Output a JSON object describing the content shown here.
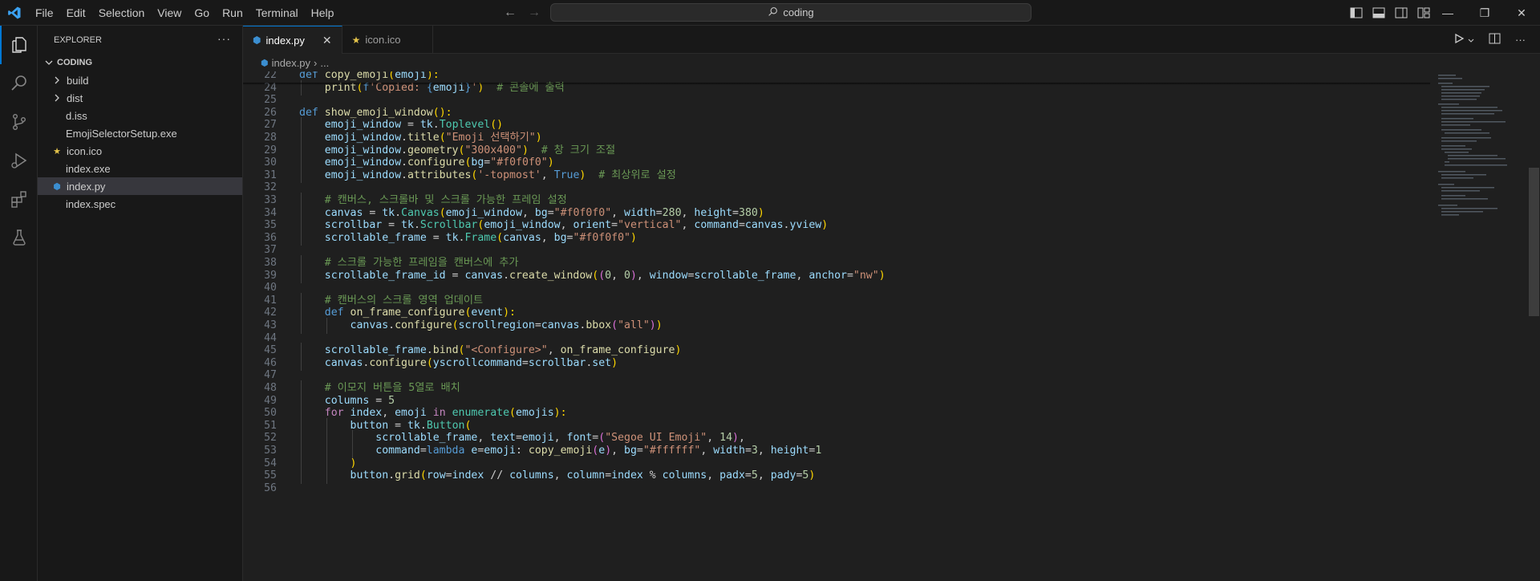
{
  "menu": [
    "File",
    "Edit",
    "Selection",
    "View",
    "Go",
    "Run",
    "Terminal",
    "Help"
  ],
  "search": {
    "text": "coding"
  },
  "explorer": {
    "title": "EXPLORER",
    "more": "···",
    "folder": "CODING",
    "items": [
      {
        "label": "build",
        "kind": "folder"
      },
      {
        "label": "dist",
        "kind": "folder"
      },
      {
        "label": "d.iss",
        "kind": "file"
      },
      {
        "label": "EmojiSelectorSetup.exe",
        "kind": "file"
      },
      {
        "label": "icon.ico",
        "kind": "icon"
      },
      {
        "label": "index.exe",
        "kind": "file"
      },
      {
        "label": "index.py",
        "kind": "python",
        "selected": true
      },
      {
        "label": "index.spec",
        "kind": "file"
      }
    ]
  },
  "tabs": [
    {
      "label": "index.py",
      "icon": "python-icon",
      "active": true,
      "close": "✕"
    },
    {
      "label": "icon.ico",
      "icon": "star-icon",
      "active": false
    }
  ],
  "breadcrumb": {
    "file": "index.py",
    "sep": "›",
    "more": "..."
  },
  "colors": {
    "accent": "#0078d4",
    "keyword": "#c586c0",
    "def": "#569cd6",
    "func": "#dcdcaa",
    "var": "#9cdcfe",
    "class": "#4ec9b0",
    "string": "#ce9178",
    "number": "#b5cea8",
    "comment": "#6a9955",
    "bracket1": "#ffd700",
    "bracket2": "#da70d6",
    "bracket3": "#179fff"
  },
  "code_lines": [
    {
      "n": "22",
      "indent": 0,
      "tokens": [
        [
          "def ",
          "d"
        ],
        [
          "copy_emoji",
          "f"
        ],
        [
          "(",
          "b1"
        ],
        [
          "emoji",
          "v"
        ],
        [
          "):",
          "b1"
        ]
      ]
    },
    {
      "n": "24",
      "indent": 1,
      "tokens": [
        [
          "print",
          "f"
        ],
        [
          "(",
          "b1"
        ],
        [
          "f",
          "d"
        ],
        [
          "'Copied: ",
          "s"
        ],
        [
          "{",
          "d"
        ],
        [
          "emoji",
          "v"
        ],
        [
          "}",
          "d"
        ],
        [
          "'",
          "s"
        ],
        [
          ")",
          "b1"
        ],
        [
          "  # 콘솔에 출력",
          "c"
        ]
      ]
    },
    {
      "n": "25",
      "indent": 0,
      "tokens": []
    },
    {
      "n": "26",
      "indent": 0,
      "tokens": [
        [
          "def ",
          "d"
        ],
        [
          "show_emoji_window",
          "f"
        ],
        [
          "():",
          "b1"
        ]
      ]
    },
    {
      "n": "27",
      "indent": 1,
      "tokens": [
        [
          "emoji_window",
          "v"
        ],
        [
          " = ",
          "p"
        ],
        [
          "tk",
          "v"
        ],
        [
          ".",
          "p"
        ],
        [
          "Toplevel",
          "k"
        ],
        [
          "()",
          "b1"
        ]
      ]
    },
    {
      "n": "28",
      "indent": 1,
      "tokens": [
        [
          "emoji_window",
          "v"
        ],
        [
          ".",
          "p"
        ],
        [
          "title",
          "f"
        ],
        [
          "(",
          "b1"
        ],
        [
          "\"Emoji 선택하기\"",
          "s"
        ],
        [
          ")",
          "b1"
        ]
      ]
    },
    {
      "n": "29",
      "indent": 1,
      "tokens": [
        [
          "emoji_window",
          "v"
        ],
        [
          ".",
          "p"
        ],
        [
          "geometry",
          "f"
        ],
        [
          "(",
          "b1"
        ],
        [
          "\"300x400\"",
          "s"
        ],
        [
          ")",
          "b1"
        ],
        [
          "  # 창 크기 조절",
          "c"
        ]
      ]
    },
    {
      "n": "30",
      "indent": 1,
      "tokens": [
        [
          "emoji_window",
          "v"
        ],
        [
          ".",
          "p"
        ],
        [
          "configure",
          "f"
        ],
        [
          "(",
          "b1"
        ],
        [
          "bg",
          "v"
        ],
        [
          "=",
          "p"
        ],
        [
          "\"#f0f0f0\"",
          "s"
        ],
        [
          ")",
          "b1"
        ]
      ]
    },
    {
      "n": "31",
      "indent": 1,
      "tokens": [
        [
          "emoji_window",
          "v"
        ],
        [
          ".",
          "p"
        ],
        [
          "attributes",
          "f"
        ],
        [
          "(",
          "b1"
        ],
        [
          "'-topmost'",
          "s"
        ],
        [
          ", ",
          "p"
        ],
        [
          "True",
          "d"
        ],
        [
          ")",
          "b1"
        ],
        [
          "  # 최상위로 설정",
          "c"
        ]
      ]
    },
    {
      "n": "32",
      "indent": 0,
      "tokens": []
    },
    {
      "n": "33",
      "indent": 1,
      "tokens": [
        [
          "# 캔버스, 스크롤바 및 스크롤 가능한 프레임 설정",
          "c"
        ]
      ]
    },
    {
      "n": "34",
      "indent": 1,
      "tokens": [
        [
          "canvas",
          "v"
        ],
        [
          " = ",
          "p"
        ],
        [
          "tk",
          "v"
        ],
        [
          ".",
          "p"
        ],
        [
          "Canvas",
          "k"
        ],
        [
          "(",
          "b1"
        ],
        [
          "emoji_window",
          "v"
        ],
        [
          ", ",
          "p"
        ],
        [
          "bg",
          "v"
        ],
        [
          "=",
          "p"
        ],
        [
          "\"#f0f0f0\"",
          "s"
        ],
        [
          ", ",
          "p"
        ],
        [
          "width",
          "v"
        ],
        [
          "=",
          "p"
        ],
        [
          "280",
          "n"
        ],
        [
          ", ",
          "p"
        ],
        [
          "height",
          "v"
        ],
        [
          "=",
          "p"
        ],
        [
          "380",
          "n"
        ],
        [
          ")",
          "b1"
        ]
      ]
    },
    {
      "n": "35",
      "indent": 1,
      "tokens": [
        [
          "scrollbar",
          "v"
        ],
        [
          " = ",
          "p"
        ],
        [
          "tk",
          "v"
        ],
        [
          ".",
          "p"
        ],
        [
          "Scrollbar",
          "k"
        ],
        [
          "(",
          "b1"
        ],
        [
          "emoji_window",
          "v"
        ],
        [
          ", ",
          "p"
        ],
        [
          "orient",
          "v"
        ],
        [
          "=",
          "p"
        ],
        [
          "\"vertical\"",
          "s"
        ],
        [
          ", ",
          "p"
        ],
        [
          "command",
          "v"
        ],
        [
          "=",
          "p"
        ],
        [
          "canvas",
          "v"
        ],
        [
          ".",
          "p"
        ],
        [
          "yview",
          "v"
        ],
        [
          ")",
          "b1"
        ]
      ]
    },
    {
      "n": "36",
      "indent": 1,
      "tokens": [
        [
          "scrollable_frame",
          "v"
        ],
        [
          " = ",
          "p"
        ],
        [
          "tk",
          "v"
        ],
        [
          ".",
          "p"
        ],
        [
          "Frame",
          "k"
        ],
        [
          "(",
          "b1"
        ],
        [
          "canvas",
          "v"
        ],
        [
          ", ",
          "p"
        ],
        [
          "bg",
          "v"
        ],
        [
          "=",
          "p"
        ],
        [
          "\"#f0f0f0\"",
          "s"
        ],
        [
          ")",
          "b1"
        ]
      ]
    },
    {
      "n": "37",
      "indent": 0,
      "tokens": []
    },
    {
      "n": "38",
      "indent": 1,
      "tokens": [
        [
          "# 스크롤 가능한 프레임을 캔버스에 추가",
          "c"
        ]
      ]
    },
    {
      "n": "39",
      "indent": 1,
      "tokens": [
        [
          "scrollable_frame_id",
          "v"
        ],
        [
          " = ",
          "p"
        ],
        [
          "canvas",
          "v"
        ],
        [
          ".",
          "p"
        ],
        [
          "create_window",
          "f"
        ],
        [
          "(",
          "b1"
        ],
        [
          "(",
          "b2"
        ],
        [
          "0",
          "n"
        ],
        [
          ", ",
          "p"
        ],
        [
          "0",
          "n"
        ],
        [
          ")",
          "b2"
        ],
        [
          ", ",
          "p"
        ],
        [
          "window",
          "v"
        ],
        [
          "=",
          "p"
        ],
        [
          "scrollable_frame",
          "v"
        ],
        [
          ", ",
          "p"
        ],
        [
          "anchor",
          "v"
        ],
        [
          "=",
          "p"
        ],
        [
          "\"nw\"",
          "s"
        ],
        [
          ")",
          "b1"
        ]
      ]
    },
    {
      "n": "40",
      "indent": 0,
      "tokens": []
    },
    {
      "n": "41",
      "indent": 1,
      "tokens": [
        [
          "# 캔버스의 스크롤 영역 업데이트",
          "c"
        ]
      ]
    },
    {
      "n": "42",
      "indent": 1,
      "tokens": [
        [
          "def ",
          "d"
        ],
        [
          "on_frame_configure",
          "f"
        ],
        [
          "(",
          "b1"
        ],
        [
          "event",
          "v"
        ],
        [
          "):",
          "b1"
        ]
      ]
    },
    {
      "n": "43",
      "indent": 2,
      "tokens": [
        [
          "canvas",
          "v"
        ],
        [
          ".",
          "p"
        ],
        [
          "configure",
          "f"
        ],
        [
          "(",
          "b1"
        ],
        [
          "scrollregion",
          "v"
        ],
        [
          "=",
          "p"
        ],
        [
          "canvas",
          "v"
        ],
        [
          ".",
          "p"
        ],
        [
          "bbox",
          "f"
        ],
        [
          "(",
          "b2"
        ],
        [
          "\"all\"",
          "s"
        ],
        [
          ")",
          "b2"
        ],
        [
          ")",
          "b1"
        ]
      ]
    },
    {
      "n": "44",
      "indent": 0,
      "tokens": []
    },
    {
      "n": "45",
      "indent": 1,
      "tokens": [
        [
          "scrollable_frame",
          "v"
        ],
        [
          ".",
          "p"
        ],
        [
          "bind",
          "f"
        ],
        [
          "(",
          "b1"
        ],
        [
          "\"<Configure>\"",
          "s"
        ],
        [
          ", ",
          "p"
        ],
        [
          "on_frame_configure",
          "f"
        ],
        [
          ")",
          "b1"
        ]
      ]
    },
    {
      "n": "46",
      "indent": 1,
      "tokens": [
        [
          "canvas",
          "v"
        ],
        [
          ".",
          "p"
        ],
        [
          "configure",
          "f"
        ],
        [
          "(",
          "b1"
        ],
        [
          "yscrollcommand",
          "v"
        ],
        [
          "=",
          "p"
        ],
        [
          "scrollbar",
          "v"
        ],
        [
          ".",
          "p"
        ],
        [
          "set",
          "v"
        ],
        [
          ")",
          "b1"
        ]
      ]
    },
    {
      "n": "47",
      "indent": 0,
      "tokens": []
    },
    {
      "n": "48",
      "indent": 1,
      "tokens": [
        [
          "# 이모지 버튼을 5열로 배치",
          "c"
        ]
      ]
    },
    {
      "n": "49",
      "indent": 1,
      "tokens": [
        [
          "columns",
          "v"
        ],
        [
          " = ",
          "p"
        ],
        [
          "5",
          "n"
        ]
      ]
    },
    {
      "n": "50",
      "indent": 1,
      "tokens": [
        [
          "for ",
          "kw"
        ],
        [
          "index",
          "v"
        ],
        [
          ", ",
          "p"
        ],
        [
          "emoji",
          "v"
        ],
        [
          " in ",
          "kw"
        ],
        [
          "enumerate",
          "k"
        ],
        [
          "(",
          "b1"
        ],
        [
          "emojis",
          "v"
        ],
        [
          "):",
          "b1"
        ]
      ]
    },
    {
      "n": "51",
      "indent": 2,
      "tokens": [
        [
          "button",
          "v"
        ],
        [
          " = ",
          "p"
        ],
        [
          "tk",
          "v"
        ],
        [
          ".",
          "p"
        ],
        [
          "Button",
          "k"
        ],
        [
          "(",
          "b1"
        ]
      ]
    },
    {
      "n": "52",
      "indent": 3,
      "tokens": [
        [
          "scrollable_frame",
          "v"
        ],
        [
          ", ",
          "p"
        ],
        [
          "text",
          "v"
        ],
        [
          "=",
          "p"
        ],
        [
          "emoji",
          "v"
        ],
        [
          ", ",
          "p"
        ],
        [
          "font",
          "v"
        ],
        [
          "=",
          "p"
        ],
        [
          "(",
          "b2"
        ],
        [
          "\"Segoe UI Emoji\"",
          "s"
        ],
        [
          ", ",
          "p"
        ],
        [
          "14",
          "n"
        ],
        [
          ")",
          "b2"
        ],
        [
          ",",
          "p"
        ]
      ]
    },
    {
      "n": "53",
      "indent": 3,
      "tokens": [
        [
          "command",
          "v"
        ],
        [
          "=",
          "p"
        ],
        [
          "lambda ",
          "d"
        ],
        [
          "e",
          "v"
        ],
        [
          "=",
          "p"
        ],
        [
          "emoji",
          "v"
        ],
        [
          ": ",
          "p"
        ],
        [
          "copy_emoji",
          "f"
        ],
        [
          "(",
          "b2"
        ],
        [
          "e",
          "v"
        ],
        [
          ")",
          "b2"
        ],
        [
          ", ",
          "p"
        ],
        [
          "bg",
          "v"
        ],
        [
          "=",
          "p"
        ],
        [
          "\"#ffffff\"",
          "s"
        ],
        [
          ", ",
          "p"
        ],
        [
          "width",
          "v"
        ],
        [
          "=",
          "p"
        ],
        [
          "3",
          "n"
        ],
        [
          ", ",
          "p"
        ],
        [
          "height",
          "v"
        ],
        [
          "=",
          "p"
        ],
        [
          "1",
          "n"
        ]
      ]
    },
    {
      "n": "54",
      "indent": 2,
      "tokens": [
        [
          ")",
          "b1"
        ]
      ]
    },
    {
      "n": "55",
      "indent": 2,
      "tokens": [
        [
          "button",
          "v"
        ],
        [
          ".",
          "p"
        ],
        [
          "grid",
          "f"
        ],
        [
          "(",
          "b1"
        ],
        [
          "row",
          "v"
        ],
        [
          "=",
          "p"
        ],
        [
          "index",
          "v"
        ],
        [
          " // ",
          "p"
        ],
        [
          "columns",
          "v"
        ],
        [
          ", ",
          "p"
        ],
        [
          "column",
          "v"
        ],
        [
          "=",
          "p"
        ],
        [
          "index",
          "v"
        ],
        [
          " % ",
          "p"
        ],
        [
          "columns",
          "v"
        ],
        [
          ", ",
          "p"
        ],
        [
          "padx",
          "v"
        ],
        [
          "=",
          "p"
        ],
        [
          "5",
          "n"
        ],
        [
          ", ",
          "p"
        ],
        [
          "pady",
          "v"
        ],
        [
          "=",
          "p"
        ],
        [
          "5",
          "n"
        ],
        [
          ")",
          "b1"
        ]
      ]
    },
    {
      "n": "56",
      "indent": 0,
      "tokens": []
    }
  ]
}
